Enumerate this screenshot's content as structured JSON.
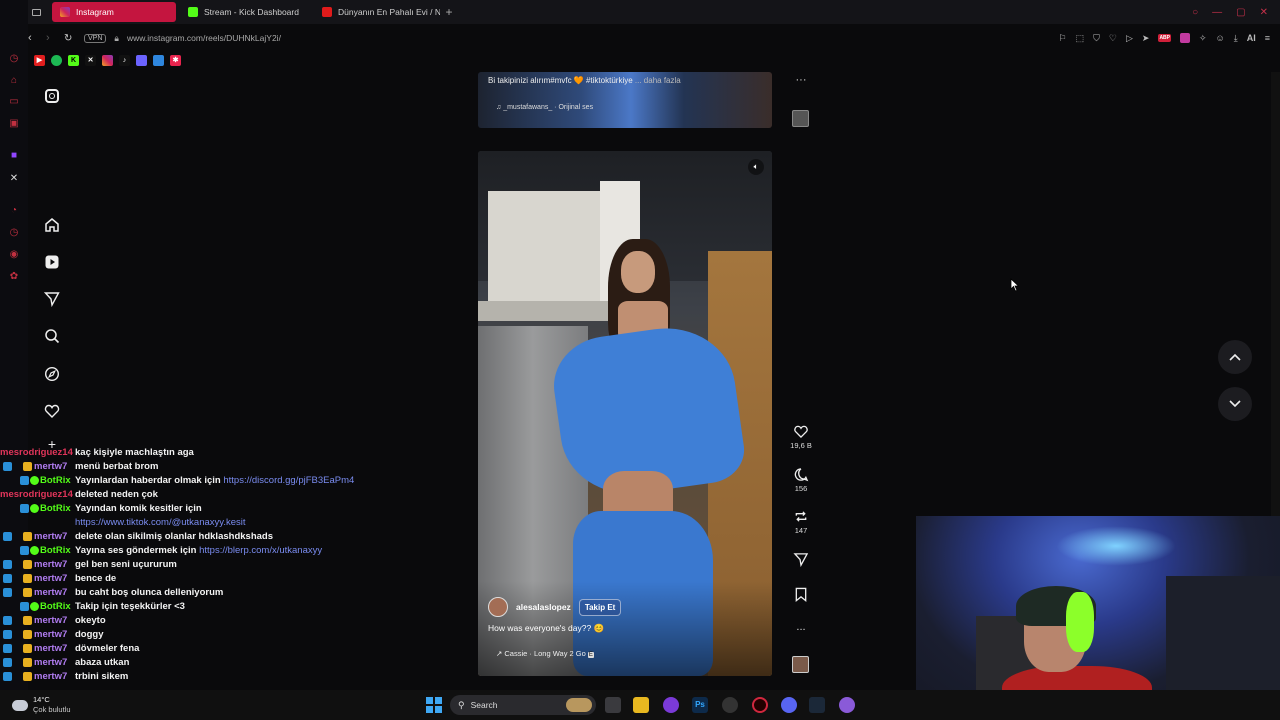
{
  "browser": {
    "tabs": [
      {
        "label": "Instagram",
        "active": true
      },
      {
        "label": "Stream - Kick Dashboard",
        "active": false
      },
      {
        "label": "Dünyanın En Pahalı Evi / N",
        "active": false
      }
    ],
    "vpn_label": "VPN",
    "url": "www.instagram.com/reels/DUHNkLajY2i/",
    "ai_label": "AI",
    "abp_label": "ABP"
  },
  "post_top": {
    "caption": "Bi takipinizi alırım#mvfc 🧡 #tiktoktürkiye",
    "more_label": "... daha fazla",
    "audio": "_mustafawans_ · Orijinal ses"
  },
  "post_main": {
    "username": "alesalaslopez",
    "follow_label": "Takip Et",
    "caption": "How was everyone's day?? 😊",
    "audio": "Cassie · Long Way 2 Go",
    "explicit_badge": "E",
    "likes": "19,6 B",
    "comments": "156",
    "reposts": "147",
    "more_label": "..."
  },
  "chat": [
    {
      "user": "mesrodriguez14",
      "color": "#e0355a",
      "msg": "kaç kişiyle machlaştın aga",
      "badges": []
    },
    {
      "user": "mertw7",
      "color": "#b07cf0",
      "msg": "menü berbat brom",
      "badges": [
        "#2a90d8",
        "#e8b020"
      ]
    },
    {
      "user": "BotRix",
      "color": "#53fc18",
      "msg": "Yayınlardan haberdar olmak için",
      "link": "https://discord.gg/pjFB3EaPm4",
      "badges": [
        "#2a90d8",
        "#53fc18"
      ]
    },
    {
      "user": "mesrodriguez14",
      "color": "#e0355a",
      "msg": "deleted neden çok",
      "badges": []
    },
    {
      "user": "BotRix",
      "color": "#53fc18",
      "msg": "Yayından komik kesitler için",
      "link2": "https://www.tiktok.com/@utkanaxyy.kesit",
      "badges": [
        "#2a90d8",
        "#53fc18"
      ]
    },
    {
      "user": "mertw7",
      "color": "#b07cf0",
      "msg": "delete olan sikilmiş olanlar hdklashdkshads",
      "badges": [
        "#2a90d8",
        "#e8b020"
      ]
    },
    {
      "user": "BotRix",
      "color": "#53fc18",
      "msg": "Yayına ses göndermek için",
      "link": "https://blerp.com/x/utkanaxyy",
      "badges": [
        "#2a90d8",
        "#53fc18"
      ]
    },
    {
      "user": "mertw7",
      "color": "#b07cf0",
      "msg": "gel ben seni uçururum",
      "badges": [
        "#2a90d8",
        "#e8b020"
      ]
    },
    {
      "user": "mertw7",
      "color": "#b07cf0",
      "msg": "bence de",
      "badges": [
        "#2a90d8",
        "#e8b020"
      ]
    },
    {
      "user": "mertw7",
      "color": "#b07cf0",
      "msg": "bu caht boş olunca delleniyorum",
      "badges": [
        "#2a90d8",
        "#e8b020"
      ]
    },
    {
      "user": "BotRix",
      "color": "#53fc18",
      "msg": "Takip için teşekkürler <3",
      "badges": [
        "#2a90d8",
        "#53fc18"
      ]
    },
    {
      "user": "mertw7",
      "color": "#b07cf0",
      "msg": "okeyto",
      "badges": [
        "#2a90d8",
        "#e8b020"
      ]
    },
    {
      "user": "mertw7",
      "color": "#b07cf0",
      "msg": "doggy",
      "badges": [
        "#2a90d8",
        "#e8b020"
      ]
    },
    {
      "user": "mertw7",
      "color": "#b07cf0",
      "msg": "dövmeler fena",
      "badges": [
        "#2a90d8",
        "#e8b020"
      ]
    },
    {
      "user": "mertw7",
      "color": "#b07cf0",
      "msg": "abaza utkan",
      "badges": [
        "#2a90d8",
        "#e8b020"
      ]
    },
    {
      "user": "mertw7",
      "color": "#b07cf0",
      "msg": "trbini sikem",
      "badges": [
        "#2a90d8",
        "#e8b020"
      ]
    }
  ],
  "taskbar": {
    "weather_temp": "14°C",
    "weather_desc": "Çok bulutlu",
    "search_label": "Search"
  },
  "colors": {
    "accent": "#c4153f",
    "kick_green": "#53fc18",
    "follow_blue": "#3b6fd8",
    "dress_blue": "#3f7fd6"
  }
}
